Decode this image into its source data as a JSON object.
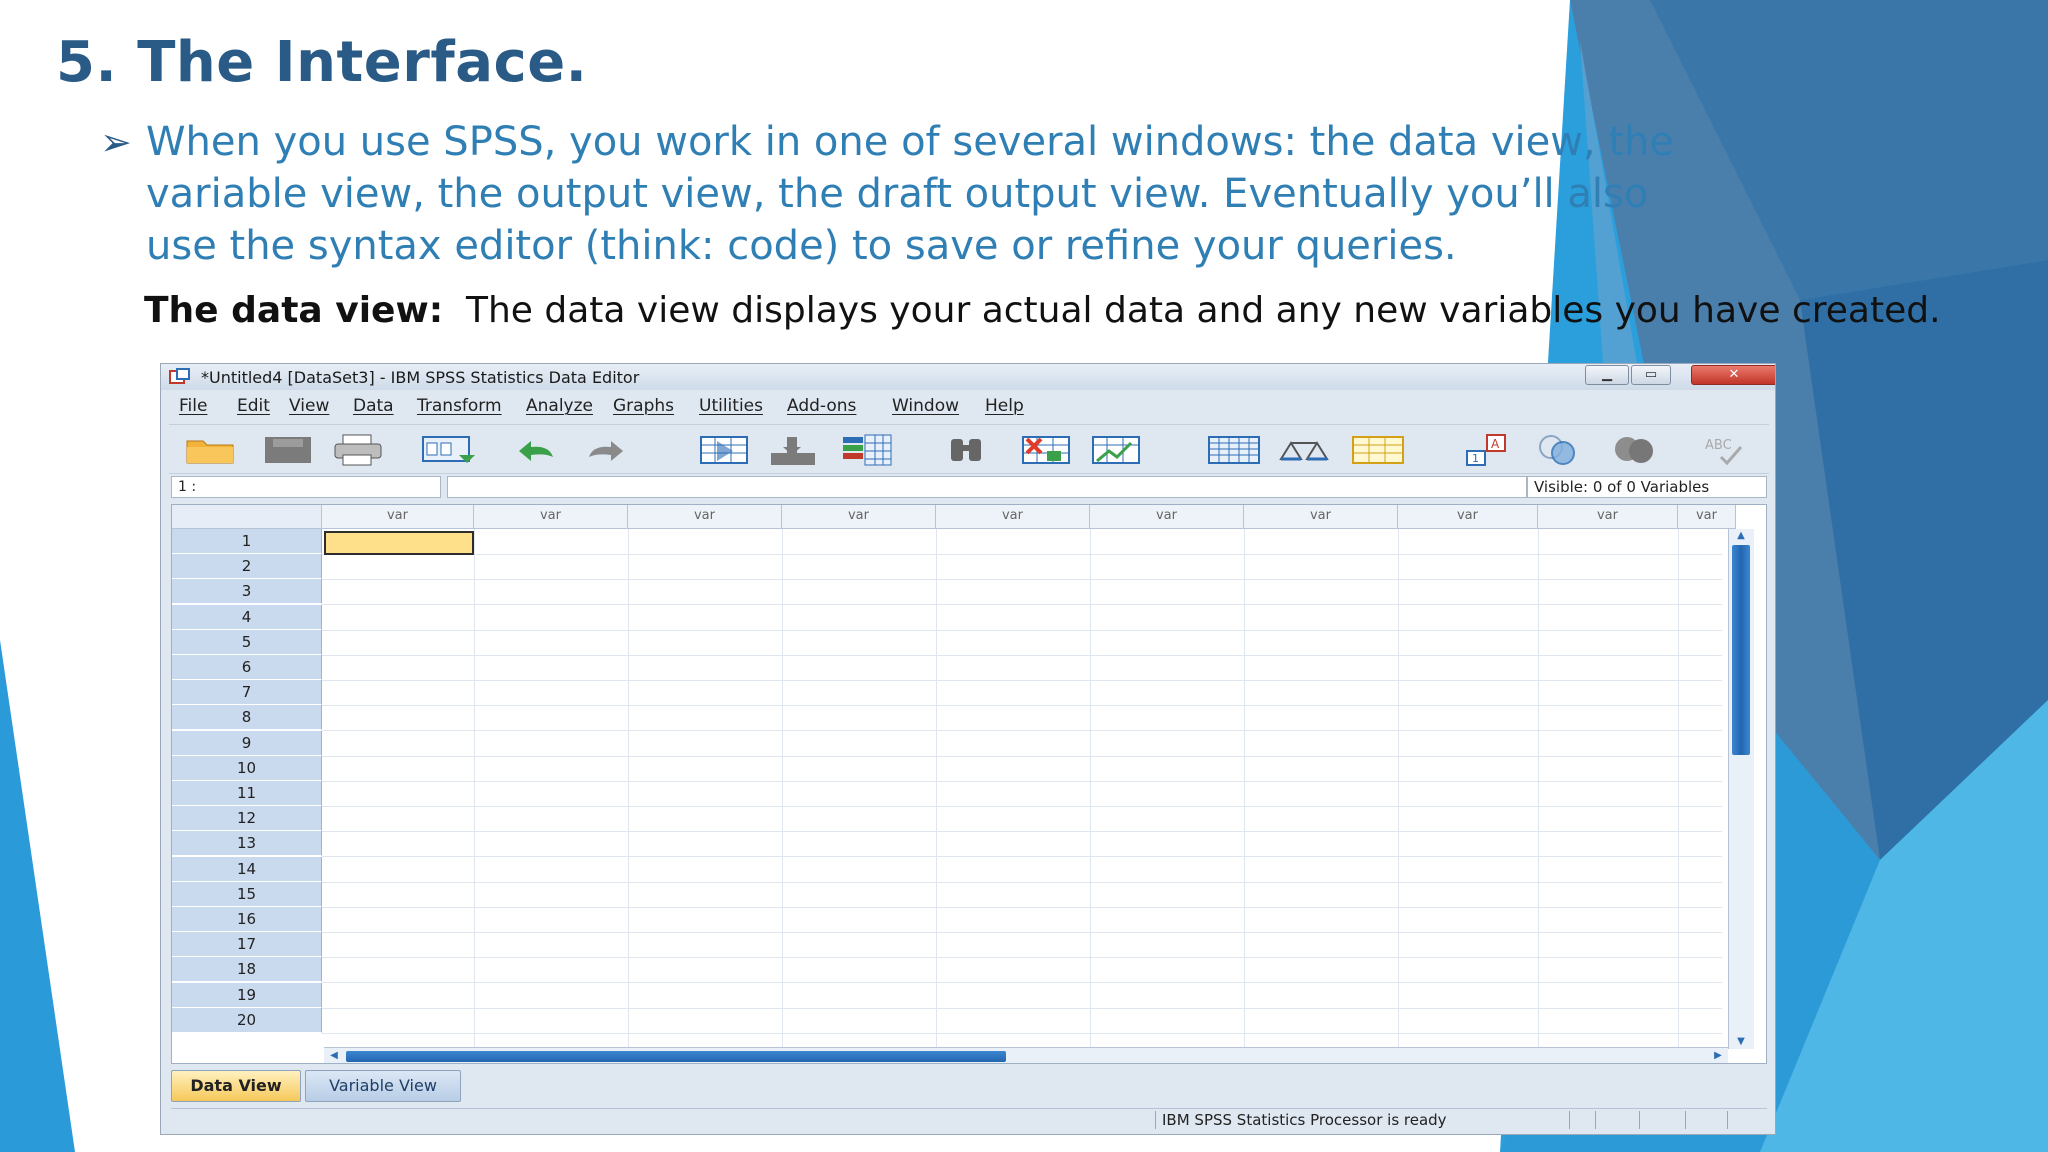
{
  "slide": {
    "title": "5. The Interface.",
    "bullet": "When you use SPSS, you work in one of several windows: the data view, the variable view, the output view, the draft output view. Eventually you’ll also use the syntax editor (think: code) to save or refine your queries.",
    "data_view_label": "The data view:",
    "data_view_text": "The data view displays your actual data and any new variables you have created."
  },
  "window": {
    "title": "*Untitled4 [DataSet3] - IBM SPSS Statistics Data Editor",
    "menu": [
      "File",
      "Edit",
      "View",
      "Data",
      "Transform",
      "Analyze",
      "Graphs",
      "Utilities",
      "Add-ons",
      "Window",
      "Help"
    ],
    "toolbar_icons": [
      "open-folder-icon",
      "save-icon",
      "print-icon",
      "recall-dialog-icon",
      "undo-icon",
      "redo-icon",
      "goto-case-icon",
      "goto-variable-icon",
      "variables-icon",
      "find-icon",
      "insert-cases-icon",
      "insert-variable-icon",
      "split-file-icon",
      "weight-cases-icon",
      "select-cases-icon",
      "value-labels-icon",
      "use-sets-icon",
      "show-all-variables-icon",
      "spell-check-icon"
    ],
    "cell_ref": "1 :",
    "visible_vars": "Visible: 0 of 0 Variables",
    "column_header": "var",
    "row_numbers": [
      "1",
      "2",
      "3",
      "4",
      "5",
      "6",
      "7",
      "8",
      "9",
      "10",
      "11",
      "12",
      "13",
      "14",
      "15",
      "16",
      "17",
      "18",
      "19",
      "20"
    ],
    "tabs": {
      "data_view": "Data View",
      "variable_view": "Variable View"
    },
    "status": "IBM SPSS Statistics Processor is ready"
  },
  "colors": {
    "title": "#2a5a86",
    "bullet": "#2f7fb5",
    "accent_blue": "#2aa6e0",
    "active_cell": "#ffe08a"
  }
}
